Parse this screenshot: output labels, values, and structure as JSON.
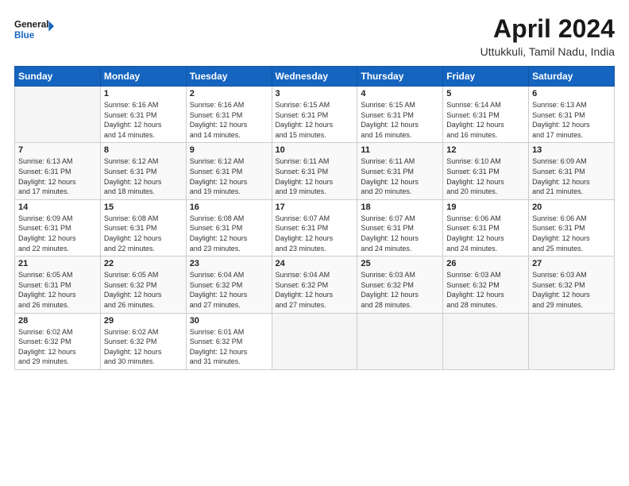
{
  "header": {
    "logo_line1": "General",
    "logo_line2": "Blue",
    "month_title": "April 2024",
    "location": "Uttukkuli, Tamil Nadu, India"
  },
  "weekdays": [
    "Sunday",
    "Monday",
    "Tuesday",
    "Wednesday",
    "Thursday",
    "Friday",
    "Saturday"
  ],
  "weeks": [
    [
      {
        "day": "",
        "info": ""
      },
      {
        "day": "1",
        "info": "Sunrise: 6:16 AM\nSunset: 6:31 PM\nDaylight: 12 hours\nand 14 minutes."
      },
      {
        "day": "2",
        "info": "Sunrise: 6:16 AM\nSunset: 6:31 PM\nDaylight: 12 hours\nand 14 minutes."
      },
      {
        "day": "3",
        "info": "Sunrise: 6:15 AM\nSunset: 6:31 PM\nDaylight: 12 hours\nand 15 minutes."
      },
      {
        "day": "4",
        "info": "Sunrise: 6:15 AM\nSunset: 6:31 PM\nDaylight: 12 hours\nand 16 minutes."
      },
      {
        "day": "5",
        "info": "Sunrise: 6:14 AM\nSunset: 6:31 PM\nDaylight: 12 hours\nand 16 minutes."
      },
      {
        "day": "6",
        "info": "Sunrise: 6:13 AM\nSunset: 6:31 PM\nDaylight: 12 hours\nand 17 minutes."
      }
    ],
    [
      {
        "day": "7",
        "info": "Sunrise: 6:13 AM\nSunset: 6:31 PM\nDaylight: 12 hours\nand 17 minutes."
      },
      {
        "day": "8",
        "info": "Sunrise: 6:12 AM\nSunset: 6:31 PM\nDaylight: 12 hours\nand 18 minutes."
      },
      {
        "day": "9",
        "info": "Sunrise: 6:12 AM\nSunset: 6:31 PM\nDaylight: 12 hours\nand 19 minutes."
      },
      {
        "day": "10",
        "info": "Sunrise: 6:11 AM\nSunset: 6:31 PM\nDaylight: 12 hours\nand 19 minutes."
      },
      {
        "day": "11",
        "info": "Sunrise: 6:11 AM\nSunset: 6:31 PM\nDaylight: 12 hours\nand 20 minutes."
      },
      {
        "day": "12",
        "info": "Sunrise: 6:10 AM\nSunset: 6:31 PM\nDaylight: 12 hours\nand 20 minutes."
      },
      {
        "day": "13",
        "info": "Sunrise: 6:09 AM\nSunset: 6:31 PM\nDaylight: 12 hours\nand 21 minutes."
      }
    ],
    [
      {
        "day": "14",
        "info": "Sunrise: 6:09 AM\nSunset: 6:31 PM\nDaylight: 12 hours\nand 22 minutes."
      },
      {
        "day": "15",
        "info": "Sunrise: 6:08 AM\nSunset: 6:31 PM\nDaylight: 12 hours\nand 22 minutes."
      },
      {
        "day": "16",
        "info": "Sunrise: 6:08 AM\nSunset: 6:31 PM\nDaylight: 12 hours\nand 23 minutes."
      },
      {
        "day": "17",
        "info": "Sunrise: 6:07 AM\nSunset: 6:31 PM\nDaylight: 12 hours\nand 23 minutes."
      },
      {
        "day": "18",
        "info": "Sunrise: 6:07 AM\nSunset: 6:31 PM\nDaylight: 12 hours\nand 24 minutes."
      },
      {
        "day": "19",
        "info": "Sunrise: 6:06 AM\nSunset: 6:31 PM\nDaylight: 12 hours\nand 24 minutes."
      },
      {
        "day": "20",
        "info": "Sunrise: 6:06 AM\nSunset: 6:31 PM\nDaylight: 12 hours\nand 25 minutes."
      }
    ],
    [
      {
        "day": "21",
        "info": "Sunrise: 6:05 AM\nSunset: 6:31 PM\nDaylight: 12 hours\nand 26 minutes."
      },
      {
        "day": "22",
        "info": "Sunrise: 6:05 AM\nSunset: 6:32 PM\nDaylight: 12 hours\nand 26 minutes."
      },
      {
        "day": "23",
        "info": "Sunrise: 6:04 AM\nSunset: 6:32 PM\nDaylight: 12 hours\nand 27 minutes."
      },
      {
        "day": "24",
        "info": "Sunrise: 6:04 AM\nSunset: 6:32 PM\nDaylight: 12 hours\nand 27 minutes."
      },
      {
        "day": "25",
        "info": "Sunrise: 6:03 AM\nSunset: 6:32 PM\nDaylight: 12 hours\nand 28 minutes."
      },
      {
        "day": "26",
        "info": "Sunrise: 6:03 AM\nSunset: 6:32 PM\nDaylight: 12 hours\nand 28 minutes."
      },
      {
        "day": "27",
        "info": "Sunrise: 6:03 AM\nSunset: 6:32 PM\nDaylight: 12 hours\nand 29 minutes."
      }
    ],
    [
      {
        "day": "28",
        "info": "Sunrise: 6:02 AM\nSunset: 6:32 PM\nDaylight: 12 hours\nand 29 minutes."
      },
      {
        "day": "29",
        "info": "Sunrise: 6:02 AM\nSunset: 6:32 PM\nDaylight: 12 hours\nand 30 minutes."
      },
      {
        "day": "30",
        "info": "Sunrise: 6:01 AM\nSunset: 6:32 PM\nDaylight: 12 hours\nand 31 minutes."
      },
      {
        "day": "",
        "info": ""
      },
      {
        "day": "",
        "info": ""
      },
      {
        "day": "",
        "info": ""
      },
      {
        "day": "",
        "info": ""
      }
    ]
  ]
}
